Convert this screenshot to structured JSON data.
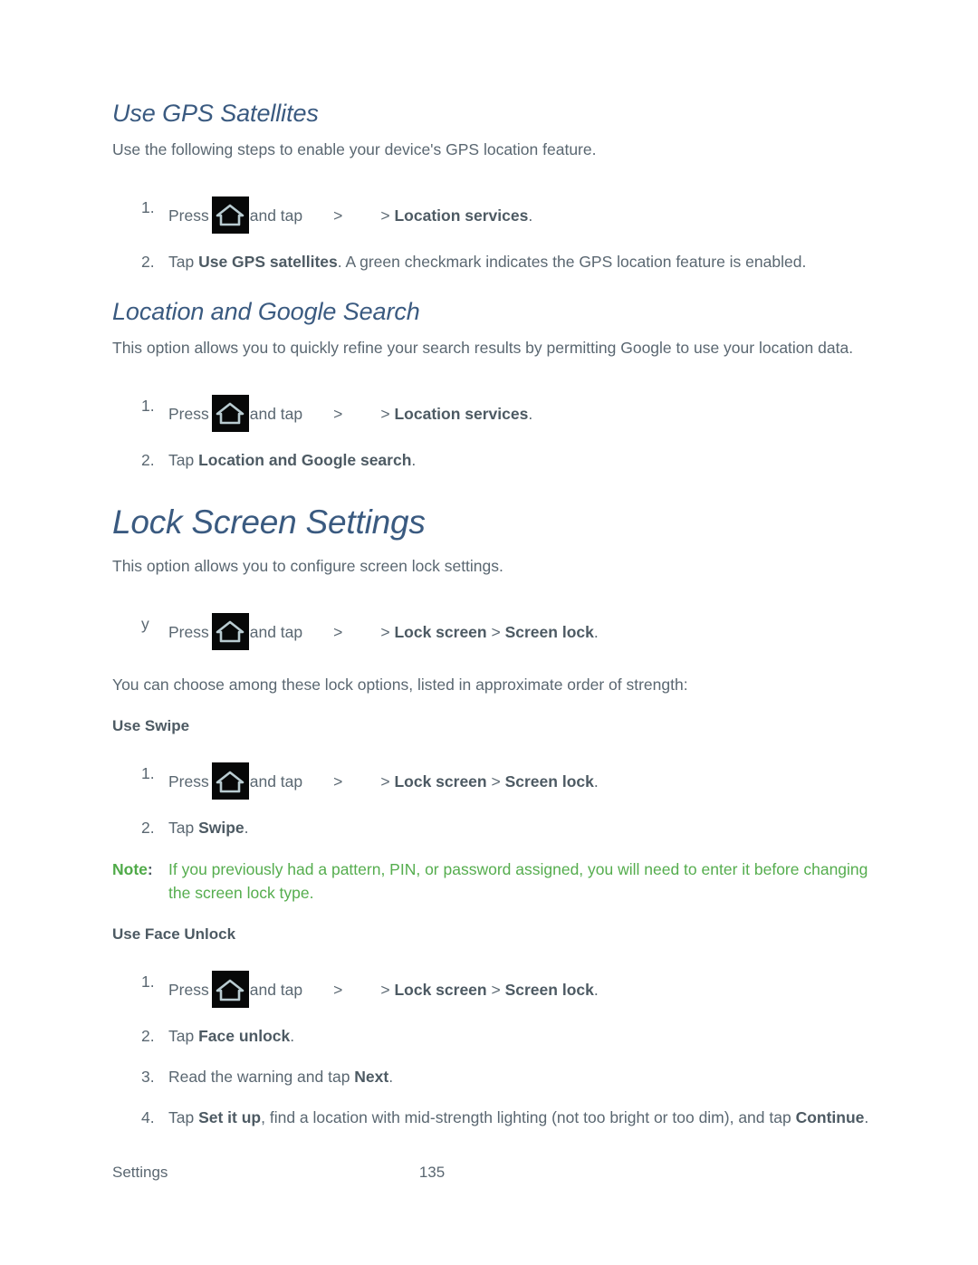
{
  "document": {
    "footer": {
      "section_label": "Settings",
      "page_number": "135"
    },
    "colors": {
      "heading": "#3a5a80",
      "body": "#5a6771",
      "bold": "#4d5a63",
      "note": "#55ad4e",
      "icon_background": "#070808",
      "icon_glyph": "#b9ccd1"
    }
  },
  "sections": [
    {
      "id": "use-gps-satellites",
      "heading": "Use GPS Satellites",
      "intro": "Use the following steps to enable your device's GPS location feature.",
      "steps": [
        {
          "marker": "1.",
          "pre_icon": "Press",
          "icon": "home-icon",
          "post_icon": "and tap",
          "chevron_1": ">",
          "chevron_2": ">",
          "target_bold": "Location services",
          "trailing": "."
        },
        {
          "marker": "2.",
          "lead": "Tap ",
          "bold": "Use GPS satellites",
          "rest": ". A green checkmark indicates the GPS location feature is enabled."
        }
      ]
    },
    {
      "id": "location-and-google-search",
      "heading": "Location and Google Search",
      "intro": "This option allows you to quickly refine your search results by permitting Google to use your location data.",
      "steps": [
        {
          "marker": "1.",
          "pre_icon": "Press",
          "icon": "home-icon",
          "post_icon": "and tap",
          "chevron_1": ">",
          "chevron_2": ">",
          "target_bold": "Location services",
          "trailing": "."
        },
        {
          "marker": "2.",
          "lead": "Tap ",
          "bold": "Location and Google search",
          "rest": "."
        }
      ]
    },
    {
      "id": "lock-screen-settings",
      "heading": "Lock Screen Settings",
      "intro": "This option allows you to configure screen lock settings.",
      "bullet_step": {
        "marker": "y",
        "pre_icon": "Press",
        "icon": "home-icon",
        "post_icon": "and tap",
        "chevron_1": ">",
        "chevron_2": ">",
        "target_bold_1": "Lock screen",
        "chevron_3": ">",
        "target_bold_2": "Screen lock",
        "trailing": "."
      },
      "outro": "You can choose among these lock options, listed in approximate order of strength:",
      "subsections": [
        {
          "id": "use-swipe",
          "subheading": "Use Swipe",
          "steps": [
            {
              "marker": "1.",
              "pre_icon": "Press",
              "icon": "home-icon",
              "post_icon": "and tap",
              "chevron_1": ">",
              "chevron_2": ">",
              "target_bold_1": "Lock screen",
              "chevron_3": ">",
              "target_bold_2": "Screen lock",
              "trailing": "."
            },
            {
              "marker": "2.",
              "lead": "Tap ",
              "bold": "Swipe",
              "rest": "."
            }
          ],
          "note": {
            "label": "Note",
            "colon": ":",
            "text": "If you previously had a pattern, PIN, or password assigned, you will need to enter it before changing the screen lock type."
          }
        },
        {
          "id": "use-face-unlock",
          "subheading": "Use Face Unlock",
          "steps": [
            {
              "marker": "1.",
              "pre_icon": "Press",
              "icon": "home-icon",
              "post_icon": "and tap",
              "chevron_1": ">",
              "chevron_2": ">",
              "target_bold_1": "Lock screen",
              "chevron_3": ">",
              "target_bold_2": "Screen lock",
              "trailing": "."
            },
            {
              "marker": "2.",
              "lead": "Tap ",
              "bold": "Face unlock",
              "rest": "."
            },
            {
              "marker": "3.",
              "lead": "Read the warning and tap ",
              "bold": "Next",
              "rest": "."
            },
            {
              "marker": "4.",
              "lead": "Tap ",
              "bold": "Set it up",
              "mid": ", find a location with mid-strength lighting (not too bright or too dim), and tap ",
              "bold2": "Continue",
              "rest": "."
            }
          ]
        }
      ]
    }
  ]
}
